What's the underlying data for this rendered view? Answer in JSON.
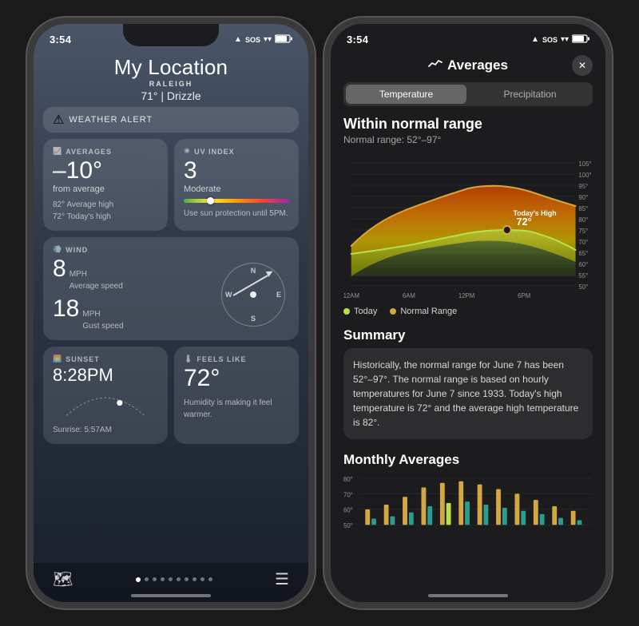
{
  "phone1": {
    "statusBar": {
      "time": "3:54",
      "locationIcon": "▲",
      "sos": "SOS",
      "wifi": "wifi",
      "battery": "79"
    },
    "header": {
      "city": "My Location",
      "sublocation": "RALEIGH",
      "tempCondition": "71° | Drizzle"
    },
    "alert": {
      "icon": "⚠",
      "text": "WEATHER ALERT"
    },
    "widgets": {
      "averages": {
        "title": "AVERAGES",
        "value": "–10°",
        "label": "from average",
        "sub1": "82° Average high",
        "sub2": "72° Today's high"
      },
      "uvIndex": {
        "title": "UV INDEX",
        "value": "3",
        "label": "Moderate",
        "advice": "Use sun protection until 5PM."
      },
      "wind": {
        "title": "WIND",
        "avgSpeed": "8",
        "avgLabel": "MPH\nAverage speed",
        "gustSpeed": "18",
        "gustLabel": "MPH\nGust speed",
        "direction": "W"
      },
      "sunset": {
        "title": "SUNSET",
        "time": "8:28PM",
        "sunrise": "Sunrise: 5:57AM"
      },
      "feelsLike": {
        "title": "FEELS LIKE",
        "value": "72°",
        "advice": "Humidity is making it feel warmer."
      }
    },
    "bottomNav": {
      "mapIcon": "🗺",
      "listIcon": "☰"
    }
  },
  "phone2": {
    "statusBar": {
      "time": "3:54",
      "locationIcon": "▲",
      "sos": "SOS",
      "battery": "79"
    },
    "header": {
      "title": "Averages",
      "closeLabel": "✕"
    },
    "tabs": [
      {
        "label": "Temperature",
        "active": true
      },
      {
        "label": "Precipitation",
        "active": false
      }
    ],
    "chart": {
      "title": "Within normal range",
      "subtitle": "Normal range: 52°–97°",
      "todayHighLabel": "Today's High",
      "todayHighValue": "72°",
      "yAxisLabels": [
        "105°",
        "100°",
        "95°",
        "90°",
        "85°",
        "80°",
        "75°",
        "70°",
        "65°",
        "60°",
        "55°",
        "50°"
      ],
      "xAxisLabels": [
        "12AM",
        "6AM",
        "12PM",
        "6PM"
      ],
      "legend": [
        {
          "label": "Today",
          "color": "#b8e04a"
        },
        {
          "label": "Normal Range",
          "color": "#d4a840"
        }
      ]
    },
    "tabs2": {
      "today": "Today",
      "normalRange": "Normal Range",
      "summary": "Summary"
    },
    "summary": {
      "title": "Summary",
      "text": "Historically, the normal range for June 7 has been 52°–97°. The normal range is based on hourly temperatures for June 7 since 1933. Today's high temperature is 72° and the average high temperature is 82°."
    },
    "monthly": {
      "title": "Monthly Averages",
      "yLabels": [
        "80°",
        "70°",
        "60°",
        "50°"
      ]
    }
  }
}
